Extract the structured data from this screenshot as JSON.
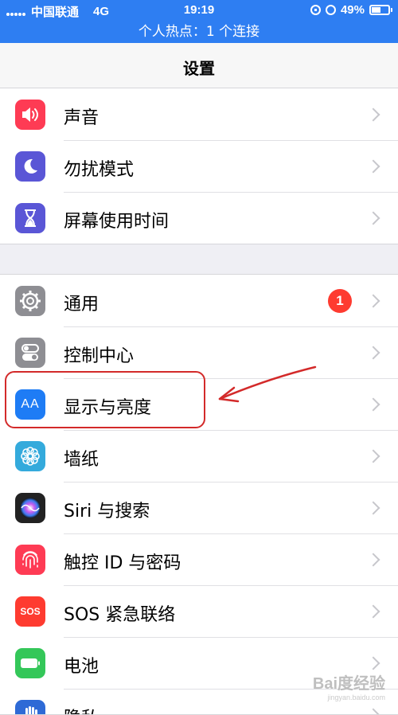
{
  "status_bar": {
    "carrier": "中国联通",
    "network": "4G",
    "time": "19:19",
    "battery_percent": "49%",
    "battery_level": 0.49
  },
  "hotspot_bar": {
    "text": "个人热点：1 个连接"
  },
  "nav": {
    "title": "设置"
  },
  "group1": {
    "items": [
      {
        "label": "声音",
        "icon": "speaker-icon",
        "color": "#fe3b54"
      },
      {
        "label": "勿扰模式",
        "icon": "moon-icon",
        "color": "#5a56d6"
      },
      {
        "label": "屏幕使用时间",
        "icon": "hourglass-icon",
        "color": "#5a56d6"
      }
    ]
  },
  "group2": {
    "items": [
      {
        "label": "通用",
        "icon": "gear-icon",
        "color": "#8e8e93",
        "badge": "1"
      },
      {
        "label": "控制中心",
        "icon": "toggles-icon",
        "color": "#8e8e93"
      },
      {
        "label": "显示与亮度",
        "icon": "text-size-icon",
        "color": "#1e7cf5",
        "icon_text": "AA"
      },
      {
        "label": "墙纸",
        "icon": "flower-icon",
        "color": "#34aadc"
      },
      {
        "label": "Siri 与搜索",
        "icon": "siri-icon",
        "color": "#222222"
      },
      {
        "label": "触控 ID 与密码",
        "icon": "fingerprint-icon",
        "color": "#fe3b54"
      },
      {
        "label": "SOS 紧急联络",
        "icon": "sos-icon",
        "color": "#fe3b30",
        "icon_text": "SOS"
      },
      {
        "label": "电池",
        "icon": "battery-icon",
        "color": "#34c759"
      },
      {
        "label": "隐私",
        "icon": "hand-icon",
        "color": "#2e6ad6"
      }
    ]
  },
  "annotation": {
    "highlight_color": "#d32a2a"
  },
  "watermark": {
    "logo": "Bai度经验",
    "url": "jingyan.baidu.com"
  }
}
